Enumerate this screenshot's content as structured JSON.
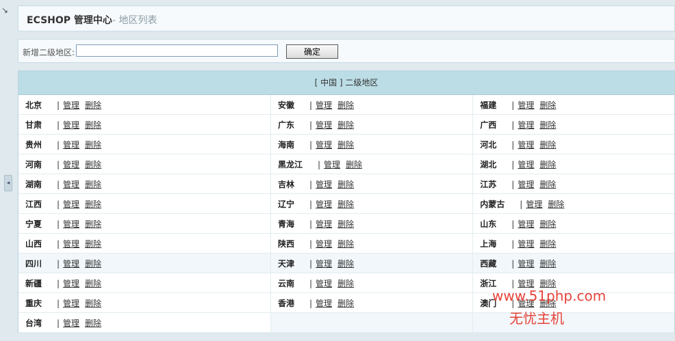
{
  "header": {
    "title": "ECSHOP 管理中心",
    "subtitle": "- 地区列表"
  },
  "form": {
    "label": "新增二级地区:",
    "value": "",
    "submit": "确定"
  },
  "list": {
    "heading": "[ 中国 ] 二级地区",
    "manage_label": "管理",
    "delete_label": "删除",
    "separator": "|",
    "rows": [
      [
        "北京",
        "安徽",
        "福建"
      ],
      [
        "甘肃",
        "广东",
        "广西"
      ],
      [
        "贵州",
        "海南",
        "河北"
      ],
      [
        "河南",
        "黑龙江",
        "湖北"
      ],
      [
        "湖南",
        "吉林",
        "江苏"
      ],
      [
        "江西",
        "辽宁",
        "内蒙古"
      ],
      [
        "宁夏",
        "青海",
        "山东"
      ],
      [
        "山西",
        "陕西",
        "上海"
      ],
      [
        "四川",
        "天津",
        "西藏"
      ],
      [
        "新疆",
        "云南",
        "浙江"
      ],
      [
        "重庆",
        "香港",
        "澳门"
      ],
      [
        "台湾"
      ]
    ]
  },
  "watermark": {
    "url": "www.51php.com",
    "name": "无忧主机"
  },
  "colors": {
    "accent_header": "#bcdde6",
    "watermark": "#e8433a"
  },
  "icons": {
    "collapse": "chevron-left-icon"
  }
}
